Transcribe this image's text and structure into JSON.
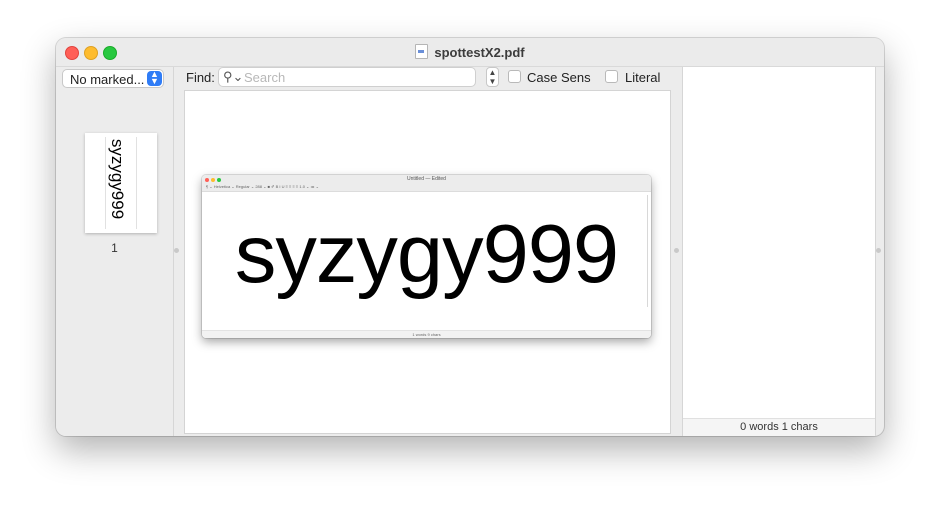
{
  "window": {
    "title": "spottestX2.pdf"
  },
  "sidebar": {
    "popup_value": "No marked...",
    "thumbnail_text": "syzygy999",
    "page_number": "1"
  },
  "findbar": {
    "label": "Find:",
    "search_placeholder": "Search",
    "case_sensitive_label": "Case Sens",
    "literal_label": "Literal"
  },
  "document": {
    "embedded_window_title": "Untitled — Edited",
    "embedded_text": "syzygy999",
    "embedded_status": "1 words 9 chars",
    "embedded_toolbar": "¶  ⌄   Helvetica    ⌄  Regular    ⌄  288  ⌄   ■  ✐   B  I  U   ≡  ≡  ≡  ≡   1.0 ⌄   ≔ ⌄"
  },
  "rightpanel": {
    "status": "0  words  1  chars"
  },
  "colors": {
    "accent": "#2f7cf6",
    "close": "#ff5f57",
    "minimize": "#febc2e",
    "maximize": "#28c840"
  }
}
